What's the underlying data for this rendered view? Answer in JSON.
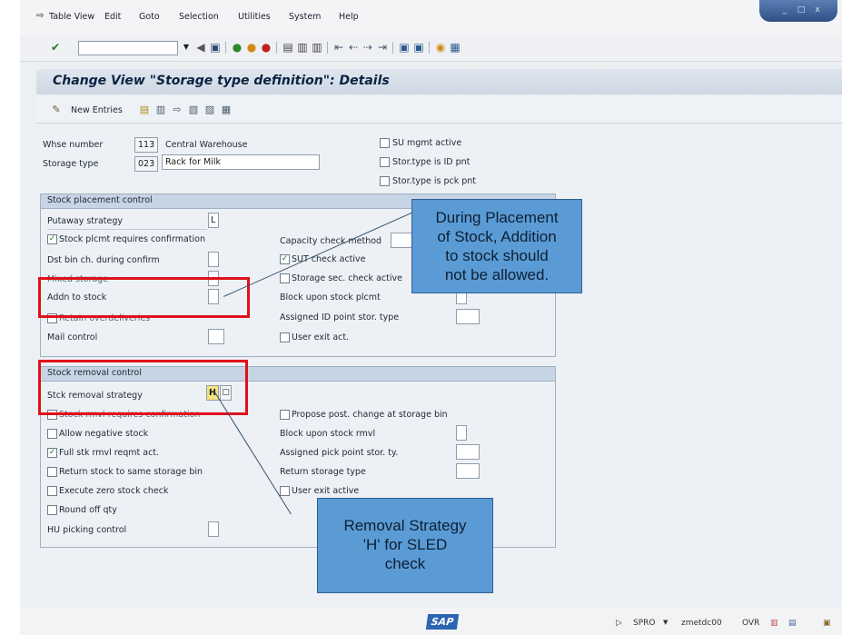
{
  "menu": {
    "items": [
      "Table View",
      "Edit",
      "Goto",
      "Selection",
      "Utilities",
      "System",
      "Help"
    ]
  },
  "window_controls": [
    "_",
    "□",
    "x"
  ],
  "toolbar": {
    "command_field_value": "",
    "icons": [
      "enter-check",
      "back",
      "save",
      "back-green",
      "exit",
      "cancel",
      "print",
      "find",
      "find-next",
      "first-page",
      "previous-page",
      "next-page",
      "last-page",
      "create-session",
      "shortcut",
      "help",
      "customize-layout"
    ]
  },
  "title": "Change View \"Storage type definition\": Details",
  "app_toolbar": {
    "new_entries_label": "New Entries",
    "icons": [
      "copy",
      "delete",
      "undo",
      "previous-entry",
      "next-entry",
      "transport"
    ]
  },
  "header": {
    "whse_number": {
      "label": "Whse number",
      "code": "113",
      "description": "Central Warehouse"
    },
    "storage_type": {
      "label": "Storage type",
      "code": "023",
      "description": "Rack for Milk"
    },
    "checkboxes": [
      {
        "label": "SU mgmt active",
        "checked": false
      },
      {
        "label": "Stor.type is ID pnt",
        "checked": false
      },
      {
        "label": "Stor.type is pck pnt",
        "checked": false
      }
    ]
  },
  "placement": {
    "title": "Stock placement control",
    "putaway_strategy": {
      "label": "Putaway strategy",
      "value": "L"
    },
    "stock_plcmt_confirm": {
      "label": "Stock plcmt requires confirmation",
      "checked": true
    },
    "dst_bin_change": {
      "label": "Dst bin ch. during confirm",
      "value": ""
    },
    "mixed_storage": {
      "label": "Mixed storage",
      "value": ""
    },
    "addn_to_stock": {
      "label": "Addn to stock",
      "value": ""
    },
    "retain_overdeliveries": {
      "label": "Retain overdeliveries",
      "checked": false
    },
    "mail_control": {
      "label": "Mail control",
      "value": ""
    },
    "capacity_check": {
      "label": "Capacity check method",
      "value": ""
    },
    "sut_check": {
      "label": "SUT check active",
      "checked": true
    },
    "storage_sec_check": {
      "label": "Storage sec. check active",
      "checked": false
    },
    "block_upon_plcmt": {
      "label": "Block upon stock plcmt",
      "value": ""
    },
    "assigned_id_point": {
      "label": "Assigned ID point stor. type",
      "value": ""
    },
    "user_exit": {
      "label": "User exit act.",
      "checked": false
    }
  },
  "removal": {
    "title": "Stock removal control",
    "removal_strategy": {
      "label": "Stck removal strategy",
      "value": "H"
    },
    "stock_rmvl_confirm": {
      "label": "Stock rmvl requires confirmation",
      "checked": false
    },
    "allow_negative": {
      "label": "Allow negative stock",
      "checked": false
    },
    "full_stk_rmvl": {
      "label": "Full stk rmvl reqmt act.",
      "checked": true
    },
    "return_stock": {
      "label": "Return stock to same storage bin",
      "checked": false
    },
    "zero_stock_check": {
      "label": "Execute zero stock check",
      "checked": false
    },
    "round_off_qty": {
      "label": "Round off qty",
      "checked": false
    },
    "hu_picking": {
      "label": "HU picking control",
      "value": ""
    },
    "propose_post_change": {
      "label": "Propose post. change at storage bin",
      "checked": false
    },
    "block_upon_rmvl": {
      "label": "Block upon stock rmvl",
      "value": ""
    },
    "assigned_pick_point": {
      "label": "Assigned pick point stor. ty.",
      "value": ""
    },
    "return_storage_type": {
      "label": "Return storage type",
      "value": ""
    },
    "user_exit": {
      "label": "User exit active",
      "checked": false
    }
  },
  "callouts": {
    "placement": [
      "During Placement",
      "of Stock, Addition",
      "to stock should",
      "not be allowed."
    ],
    "removal": [
      "Removal Strategy",
      "'H' for SLED",
      "check"
    ]
  },
  "statusbar": {
    "logo": "SAP",
    "transaction": "SPRO",
    "server": "zmetdc00",
    "mode": "OVR"
  },
  "colors": {
    "highlight": "#e0101a",
    "callout_bg": "#5b9bd5",
    "group_header": "#c6d4e3"
  }
}
